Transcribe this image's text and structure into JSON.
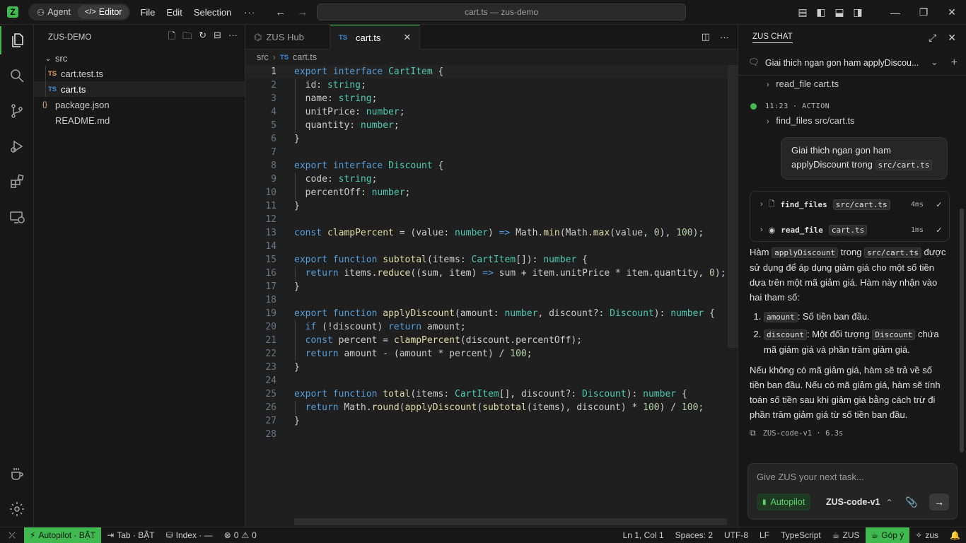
{
  "titlebar": {
    "modes": [
      "Agent",
      "Editor"
    ],
    "menu": [
      "File",
      "Edit",
      "Selection"
    ],
    "more": "···",
    "search_text": "cart.ts — zus-demo"
  },
  "explorer": {
    "title": "ZUS-DEMO",
    "folder": "src",
    "files": [
      {
        "badge": "TS",
        "name": "cart.test.ts"
      },
      {
        "badge": "TS",
        "name": "cart.ts"
      },
      {
        "badge": "{}",
        "name": "package.json"
      },
      {
        "badge": "",
        "name": "README.md"
      }
    ]
  },
  "editor": {
    "tabs": [
      {
        "label": "ZUS Hub"
      },
      {
        "badge": "TS",
        "label": "cart.ts"
      }
    ],
    "breadcrumb": [
      "src",
      "TS",
      "cart.ts"
    ],
    "line_count": 28,
    "current_line": 1
  },
  "chat": {
    "title": "ZUS CHAT",
    "conversation_title": "Giai thich ngan gon ham applyDiscou...",
    "events": [
      {
        "label": "read_file cart.ts"
      },
      {
        "time": "11:23 · ACTION",
        "label": "find_files src/cart.ts"
      }
    ],
    "user_message_prefix": "Giai thich ngan gon ham applyDiscount trong",
    "user_message_code": "src/cart.ts",
    "tool_calls": [
      {
        "name": "find_files",
        "arg": "src/cart.ts",
        "time": "4ms"
      },
      {
        "name": "read_file",
        "arg": "cart.ts",
        "time": "1ms"
      }
    ],
    "answer": {
      "p1_a": "Hàm",
      "p1_code1": "applyDiscount",
      "p1_b": "trong",
      "p1_code2": "src/cart.ts",
      "p1_c": "được sử dụng để áp dụng giảm giá cho một số tiền dựa trên một mã giảm giá. Hàm này nhận vào hai tham số:",
      "li1_code": "amount",
      "li1_text": ": Số tiền ban đầu.",
      "li2_code": "discount",
      "li2_text_a": ": Một đối tượng",
      "li2_code2": "Discount",
      "li2_text_b": "chứa mã giảm giá và phần trăm giảm giá.",
      "p2": "Nếu không có mã giảm giá, hàm sẽ trả về số tiền ban đầu. Nếu có mã giảm giá, hàm sẽ tính toán số tiền sau khi giảm giá bằng cách trừ đi phần trăm giảm giá từ số tiền ban đầu."
    },
    "meta": "ZUS-code-v1 · 6.3s",
    "composer": {
      "placeholder": "Give ZUS your next task...",
      "autopilot": "Autopilot",
      "model": "ZUS-code-v1"
    }
  },
  "statusbar": {
    "autopilot": "Autopilot · BẬT",
    "tab": "Tab · BẬT",
    "index": "Index · —",
    "errors": "0",
    "warnings": "0",
    "position": "Ln 1, Col 1",
    "spaces": "Spaces: 2",
    "encoding": "UTF-8",
    "eol": "LF",
    "language": "TypeScript",
    "zus": "ZUS",
    "feedback": "Góp ý",
    "user": "zus"
  },
  "colors": {
    "accent": "#3fb950",
    "keyword": "#569cd6",
    "type": "#4ec9b0",
    "function": "#dcdcaa",
    "number": "#b5cea8"
  }
}
